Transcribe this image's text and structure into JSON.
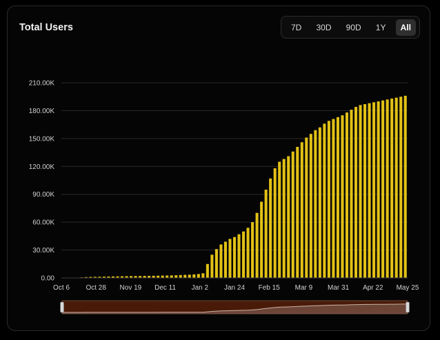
{
  "header": {
    "title": "Total Users"
  },
  "range_selector": {
    "options": [
      "7D",
      "30D",
      "90D",
      "1Y",
      "All"
    ],
    "selected": "All"
  },
  "colors": {
    "bar": "#e2c115",
    "background": "#050505",
    "grid": "#2b2b2b",
    "navigator_fill": "#4a1a08"
  },
  "chart_data": {
    "type": "bar",
    "title": "Total Users",
    "xlabel": "",
    "ylabel": "",
    "ylim": [
      0,
      210000
    ],
    "yticks": [
      "0.00",
      "30.00K",
      "60.00K",
      "90.00K",
      "120.00K",
      "150.00K",
      "180.00K",
      "210.00K"
    ],
    "xticks": [
      "Oct 6",
      "Oct 28",
      "Nov 19",
      "Dec 11",
      "Jan 2",
      "Jan 24",
      "Feb 15",
      "Mar 9",
      "Mar 31",
      "Apr 22",
      "May 25"
    ],
    "grid": true,
    "legend": "none",
    "series": [
      {
        "values": [
          0,
          0,
          100,
          300,
          600,
          900,
          1100,
          1200,
          1300,
          1400,
          1500,
          1600,
          1700,
          1800,
          1900,
          2000,
          2050,
          2100,
          2150,
          2200,
          2300,
          2400,
          2500,
          2600,
          2700,
          2900,
          3100,
          3300,
          3500,
          3800,
          4200,
          5000,
          15000,
          25000,
          31000,
          36000,
          39000,
          42000,
          44000,
          47000,
          50000,
          54000,
          60000,
          70000,
          82000,
          95000,
          107000,
          118000,
          125000,
          128000,
          131000,
          136000,
          141000,
          146000,
          151000,
          155000,
          159000,
          162000,
          166000,
          169000,
          171000,
          173000,
          175000,
          178000,
          181000,
          184000,
          186000,
          187000,
          188000,
          189000,
          190000,
          191000,
          192000,
          193000,
          194000,
          195000,
          196000
        ]
      }
    ]
  }
}
